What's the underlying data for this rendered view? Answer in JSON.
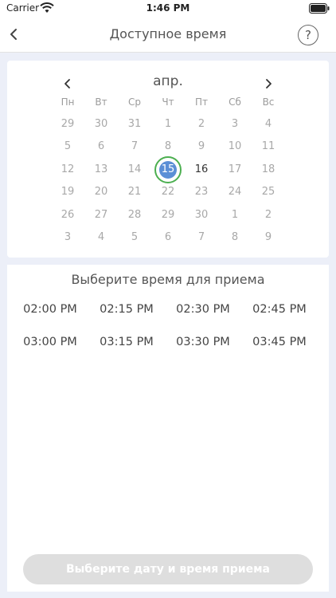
{
  "status_bar": {
    "carrier": "Carrier",
    "time": "1:46 PM",
    "icons": [
      "wifi-icon",
      "battery-icon"
    ]
  },
  "nav": {
    "title": "Доступное время",
    "back_icon": "chevron-left-icon",
    "help_label": "?"
  },
  "calendar": {
    "month": "апр.",
    "prev_icon": "chevron-left-icon",
    "next_icon": "chevron-right-icon",
    "weekdays": [
      "Пн",
      "Вт",
      "Ср",
      "Чт",
      "Пт",
      "Сб",
      "Вс"
    ],
    "weeks": [
      [
        "29",
        "30",
        "31",
        "1",
        "2",
        "3",
        "4"
      ],
      [
        "5",
        "6",
        "7",
        "8",
        "9",
        "10",
        "11"
      ],
      [
        "12",
        "13",
        "14",
        "15",
        "16",
        "17",
        "18"
      ],
      [
        "19",
        "20",
        "21",
        "22",
        "23",
        "24",
        "25"
      ],
      [
        "26",
        "27",
        "28",
        "29",
        "30",
        "1",
        "2"
      ],
      [
        "3",
        "4",
        "5",
        "6",
        "7",
        "8",
        "9"
      ]
    ],
    "selected_day": "15",
    "available_days": [
      "15",
      "16"
    ],
    "selected_fill_color": "#5b8fd6",
    "selected_ring_color": "#4caf50"
  },
  "time_section": {
    "heading": "Выберите время для приема",
    "slots": [
      [
        "02:00 PM",
        "02:15 PM",
        "02:30 PM",
        "02:45 PM"
      ],
      [
        "03:00 PM",
        "03:15 PM",
        "03:30 PM",
        "03:45 PM"
      ]
    ]
  },
  "confirm_button": {
    "label": "Выберите дату и время приема",
    "disabled_color": "#dedede"
  }
}
